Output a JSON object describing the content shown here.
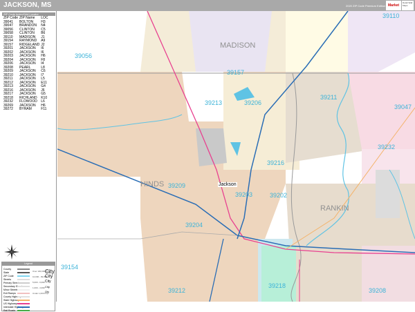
{
  "header": {
    "title": "JACKSON, MS",
    "edition": "2020 ZIP Code Premium Edition",
    "logo": "Market MAPS",
    "logo_sub": "Detail Wall Maps"
  },
  "index": {
    "title": "ZIP Code Index/Grid Locator",
    "columns": [
      "ZIP Code",
      "ZIP Name",
      "LOC"
    ],
    "rows": [
      [
        "39041",
        "BOLTON",
        "H3"
      ],
      [
        "39047",
        "BRANDON",
        "N4"
      ],
      [
        "39056",
        "CLINTON",
        "C5"
      ],
      [
        "39058",
        "CLINTON",
        "B6"
      ],
      [
        "39110",
        "MADISON",
        "J1"
      ],
      [
        "39154",
        "RAYMOND",
        "A9"
      ],
      [
        "39157",
        "RIDGELAND",
        "J2"
      ],
      [
        "39201",
        "JACKSON",
        "I6"
      ],
      [
        "39202",
        "JACKSON",
        "I6"
      ],
      [
        "39203",
        "JACKSON",
        "H6"
      ],
      [
        "39204",
        "JACKSON",
        "F8"
      ],
      [
        "39206",
        "JACKSON",
        "I4"
      ],
      [
        "39208",
        "PEARL",
        "L8"
      ],
      [
        "39209",
        "JACKSON",
        "C6"
      ],
      [
        "39210",
        "JACKSON",
        "I7"
      ],
      [
        "39211",
        "JACKSON",
        "L5"
      ],
      [
        "39212",
        "JACKSON",
        "E11"
      ],
      [
        "39213",
        "JACKSON",
        "G4"
      ],
      [
        "39216",
        "JACKSON",
        "J6"
      ],
      [
        "39217",
        "JACKSON",
        "G5"
      ],
      [
        "39218",
        "RICHLAND",
        "K10"
      ],
      [
        "39232",
        "FLOWOOD",
        "L6"
      ],
      [
        "39269",
        "JACKSON",
        "H6"
      ],
      [
        "39272",
        "BYRAM",
        "F11"
      ]
    ]
  },
  "legend": {
    "title": "Legend",
    "items": [
      {
        "label": "County",
        "color": "#888888"
      },
      {
        "label": "State",
        "color": "#555555"
      },
      {
        "label": "ZIP Code",
        "color": "#7fd6f0"
      },
      {
        "label": "Streets",
        "color": "#dddddd"
      },
      {
        "label": "Primary Streets",
        "color": "#cccccc"
      },
      {
        "label": "Secondary Streets",
        "color": "#dddddd"
      },
      {
        "label": "Minor Streets",
        "color": "#eeeeee"
      },
      {
        "label": "Exit Ramps",
        "color": "#f0c0c0"
      },
      {
        "label": "County Highways",
        "color": "#e0e0e0"
      },
      {
        "label": "State Highways",
        "color": "#f4b36a"
      },
      {
        "label": "US Highways",
        "color": "#e8408f"
      },
      {
        "label": "Interstate Highways",
        "color": "#2a6db5"
      },
      {
        "label": "Rail Roads",
        "color": "#44aa44"
      }
    ],
    "city_sizes": [
      {
        "range": "Over 100,000 Pop.",
        "label": "City"
      },
      {
        "range": "10,000 - 99,999",
        "label": "City"
      },
      {
        "range": "5,000 - 9,999",
        "label": "City"
      },
      {
        "range": "1,000 - 4,999",
        "label": "City"
      },
      {
        "range": "Under 1,000 Pop.",
        "label": "City"
      }
    ]
  },
  "map": {
    "counties": [
      {
        "name": "MADISON"
      },
      {
        "name": "HINDS"
      },
      {
        "name": "RANKIN"
      }
    ],
    "city": "Jackson",
    "zips": [
      "39157",
      "39110",
      "39056",
      "39213",
      "39206",
      "39211",
      "39047",
      "39232",
      "39216",
      "39209",
      "39203",
      "39202",
      "39204",
      "39154",
      "39212",
      "39218",
      "39208"
    ]
  }
}
